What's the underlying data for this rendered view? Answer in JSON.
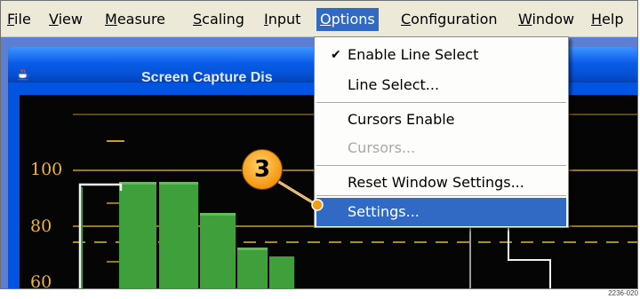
{
  "menubar": {
    "items": [
      {
        "key": "F",
        "rest": "ile"
      },
      {
        "key": "V",
        "rest": "iew"
      },
      {
        "key": "M",
        "rest": "easure"
      },
      {
        "key": "S",
        "rest": "caling"
      },
      {
        "key": "I",
        "rest": "nput"
      },
      {
        "key": "O",
        "rest": "ptions"
      },
      {
        "key": "C",
        "rest": "onfiguration"
      },
      {
        "key": "W",
        "rest": "indow"
      },
      {
        "key": "H",
        "rest": "elp"
      }
    ],
    "active": "Options"
  },
  "window": {
    "title": "Screen Capture Dis",
    "icon": "java-cup-icon"
  },
  "scope": {
    "scale_labels": [
      "100",
      "80",
      "60"
    ],
    "trace_color": "#3f9f3a",
    "scale_color": "#f0b43c"
  },
  "options_menu": {
    "items": [
      {
        "label": "Enable Line Select",
        "checked": true,
        "enabled": true
      },
      {
        "label": "Line Select...",
        "checked": false,
        "enabled": true
      },
      {
        "label": "Cursors Enable",
        "checked": false,
        "enabled": true
      },
      {
        "label": "Cursors...",
        "checked": false,
        "enabled": false
      },
      {
        "label": "Reset Window Settings...",
        "checked": false,
        "enabled": true
      },
      {
        "label": "Settings...",
        "checked": false,
        "enabled": true,
        "highlighted": true
      }
    ],
    "check_glyph": "✔"
  },
  "callout": {
    "step": "3"
  },
  "figure_id": "2236-020",
  "colors": {
    "menu_highlight": "#316ac5",
    "menubar_bg": "#ece9d8",
    "callout": "#f59b16"
  }
}
